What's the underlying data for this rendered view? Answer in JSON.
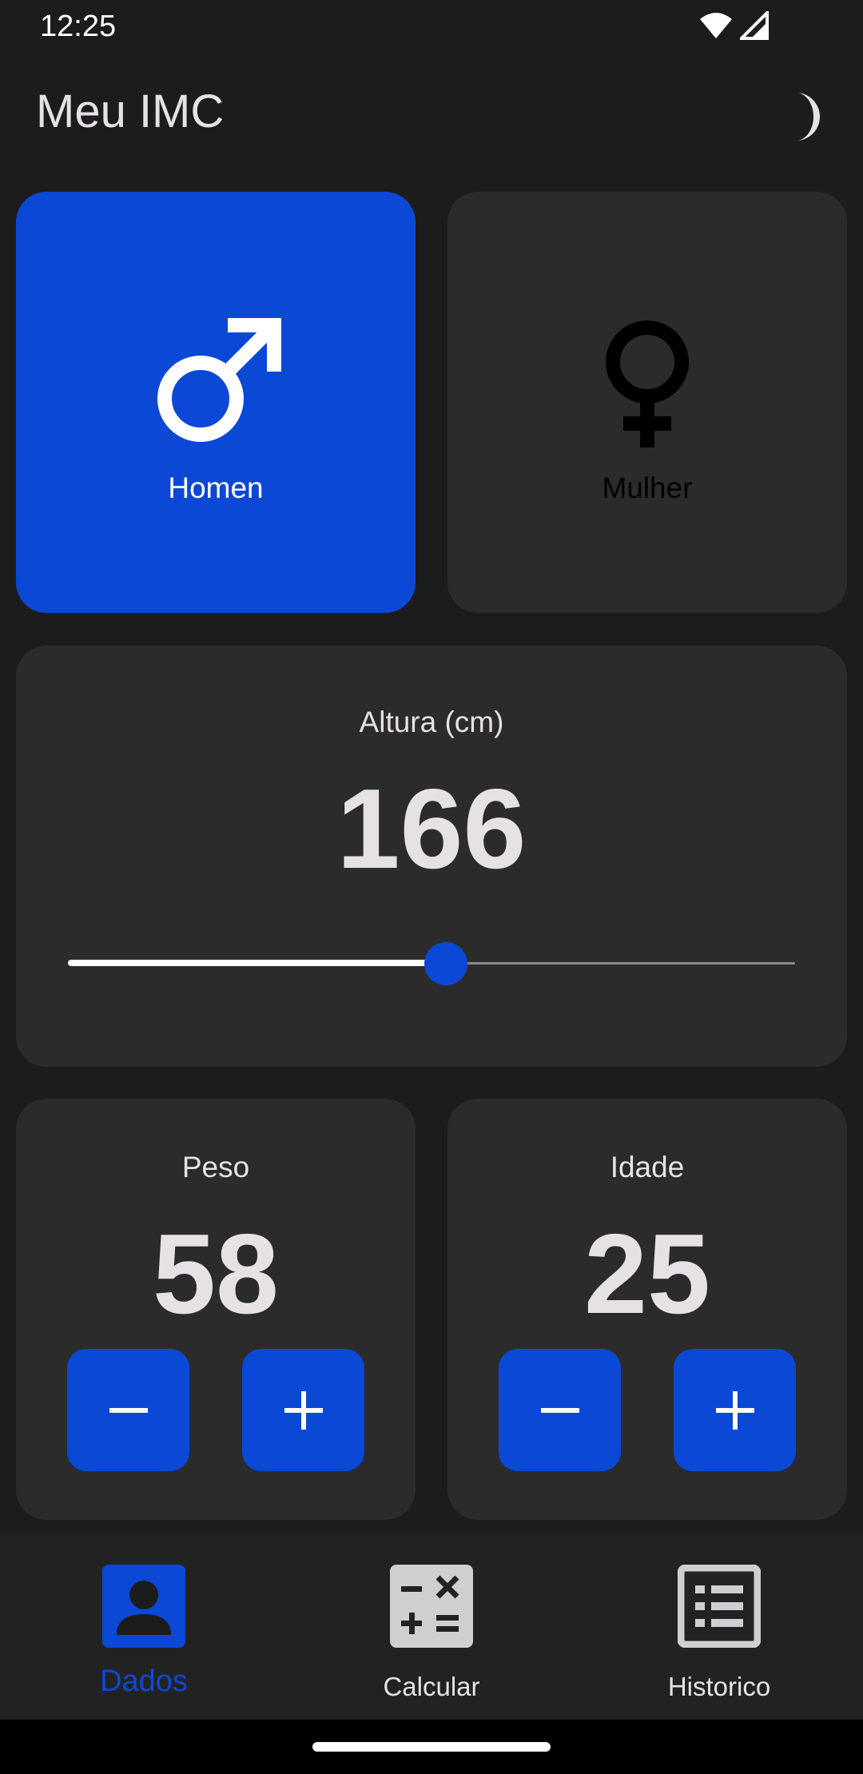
{
  "status_bar": {
    "time": "12:25",
    "icons": [
      "wifi-icon",
      "signal-icon"
    ]
  },
  "app_bar": {
    "title": "Meu IMC",
    "theme_icon": "moon-icon"
  },
  "gender": {
    "male": {
      "label": "Homen",
      "icon": "male-symbol-icon",
      "selected": true
    },
    "female": {
      "label": "Mulher",
      "icon": "female-symbol-icon",
      "selected": false
    }
  },
  "height": {
    "label": "Altura (cm)",
    "value": "166",
    "slider_fraction": 0.52
  },
  "weight": {
    "label": "Peso",
    "value": "58",
    "decrement_icon": "minus-icon",
    "increment_icon": "plus-icon"
  },
  "age": {
    "label": "Idade",
    "value": "25",
    "decrement_icon": "minus-icon",
    "increment_icon": "plus-icon"
  },
  "bottom_nav": {
    "items": [
      {
        "label": "Dados",
        "icon": "person-icon",
        "active": true
      },
      {
        "label": "Calcular",
        "icon": "calculator-icon",
        "active": false
      },
      {
        "label": "Historico",
        "icon": "list-icon",
        "active": false
      }
    ]
  },
  "colors": {
    "accent": "#0b48d6",
    "card": "#2b2b2c",
    "background": "#1c1c1d"
  }
}
